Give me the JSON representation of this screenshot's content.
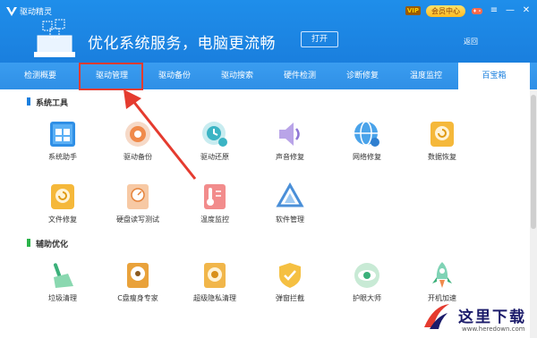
{
  "app": {
    "title": "驱动精灵",
    "vip_badge": "VIP",
    "member_center": "会员中心",
    "controls": {
      "menu": "≡",
      "minimize": "—",
      "close": "✕"
    }
  },
  "hero": {
    "slogan": "优化系统服务，电脑更流畅",
    "open_button": "打开",
    "back_link": "返回"
  },
  "tabs": [
    {
      "label": "检测概要",
      "active": false
    },
    {
      "label": "驱动管理",
      "active": false
    },
    {
      "label": "驱动备份",
      "active": false
    },
    {
      "label": "驱动搜索",
      "active": false
    },
    {
      "label": "硬件检测",
      "active": false
    },
    {
      "label": "诊断修复",
      "active": false
    },
    {
      "label": "温度监控",
      "active": false
    },
    {
      "label": "百宝箱",
      "active": true
    }
  ],
  "sections": {
    "system_tools": {
      "title": "系统工具",
      "items": [
        {
          "label": "系统助手",
          "icon": "system-assistant-icon"
        },
        {
          "label": "驱动备份",
          "icon": "driver-backup-icon"
        },
        {
          "label": "驱动还原",
          "icon": "driver-restore-icon"
        },
        {
          "label": "声音修复",
          "icon": "sound-repair-icon"
        },
        {
          "label": "网络修复",
          "icon": "network-repair-icon"
        },
        {
          "label": "数据恢复",
          "icon": "data-recovery-icon"
        },
        {
          "label": "文件修复",
          "icon": "file-repair-icon"
        },
        {
          "label": "硬盘读写测试",
          "icon": "disk-test-icon"
        },
        {
          "label": "温度监控",
          "icon": "temperature-icon"
        },
        {
          "label": "软件管理",
          "icon": "software-manager-icon"
        }
      ]
    },
    "aux_optimize": {
      "title": "辅助优化",
      "items": [
        {
          "label": "垃圾清理",
          "icon": "broom-icon"
        },
        {
          "label": "C盘瘦身专家",
          "icon": "c-drive-slim-icon"
        },
        {
          "label": "超级隐私清理",
          "icon": "privacy-clean-icon"
        },
        {
          "label": "弹窗拦截",
          "icon": "popup-block-icon"
        },
        {
          "label": "护眼大师",
          "icon": "eye-care-icon"
        },
        {
          "label": "开机加速",
          "icon": "boot-speedup-icon"
        }
      ]
    }
  },
  "colors": {
    "header": "#1a7fde",
    "tabbar": "#2f8fe6",
    "highlight": "#e53b2f",
    "section_blue": "#1a7fde",
    "section_green": "#2bb34a"
  },
  "watermark": {
    "text": "这里下载",
    "url": "www.heredown.com"
  }
}
